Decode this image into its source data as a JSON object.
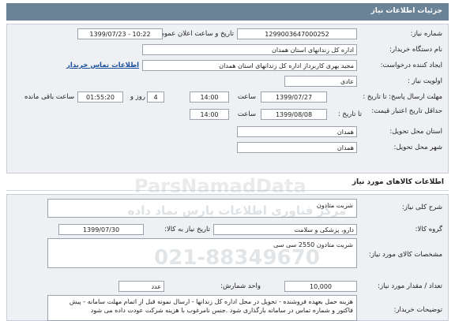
{
  "header": {
    "title": "جزئیات اطلاعات نیاز"
  },
  "info": {
    "need_number_label": "شماره نیاز:",
    "need_number": "1299003647000252",
    "announce_label": "تاریخ و ساعت اعلان عمومی:",
    "announce_value": "1399/07/23 - 10:22",
    "buyer_label": "نام دستگاه خریدار:",
    "buyer_value": "اداره کل زندانهای استان همدان",
    "creator_label": "ایجاد کننده درخواست:",
    "creator_value": "مجید بهری کاربرداز اداره کل زندانهای استان همدان",
    "contact_link": "اطلاعات تماس خریدار",
    "priority_label": "اولویت نیاز :",
    "priority_value": "عادی",
    "reply_deadline_label": "مهلت ارسال پاسخ: تا تاریخ :",
    "reply_date": "1399/07/27",
    "time_label": "ساعت",
    "reply_time": "14:00",
    "days_label": "روز و",
    "days_value": "4",
    "remaining_time": "01:55:20",
    "remaining_label": "ساعت باقی مانده",
    "validity_label": "حداقل تاریخ اعتبار قیمت:",
    "validity_to_label": "تا تاریخ :",
    "validity_date": "1399/08/08",
    "validity_time": "14:00",
    "province_label": "استان محل تحویل:",
    "province_value": "همدان",
    "city_label": "شهر محل تحویل:",
    "city_value": "همدان"
  },
  "goods": {
    "section_title": "اطلاعات کالاهای مورد نیاز",
    "desc_label": "شرح کلی نیاز:",
    "desc_value": "شربت متادون",
    "group_label": "گروه کالا:",
    "group_value": "دارو، پزشکی و سلامت",
    "need_date_label": "تاریخ نیاز به کالا:",
    "need_date_value": "1399/07/30",
    "spec_label": "مشخصات کالای مورد نیاز:",
    "spec_value": "شربت متادون 2550 سی سی",
    "unit_label": "واحد شمارش:",
    "unit_value": "عدد",
    "qty_label": "تعداد / مقدار مورد نیاز:",
    "qty_value": "10,000",
    "buyer_notes_label": "توضیحات خریدار:",
    "buyer_notes_value": "هزینه حمل بعهده فروشنده - تحویل در محل اداره کل زندانها - ارسال نمونه قبل از اتمام مهلت سامانه - پیش فاکتور و شماره تماس در سامانه بارگذاری شود .جنس نامرغوب با هزینه شرکت عودت داده می شود"
  },
  "watermark": {
    "line1": "مرکز فناوری اطلاعات پارس نماد داده",
    "line2": "021-88349670",
    "brand": "ParsNamadData"
  }
}
